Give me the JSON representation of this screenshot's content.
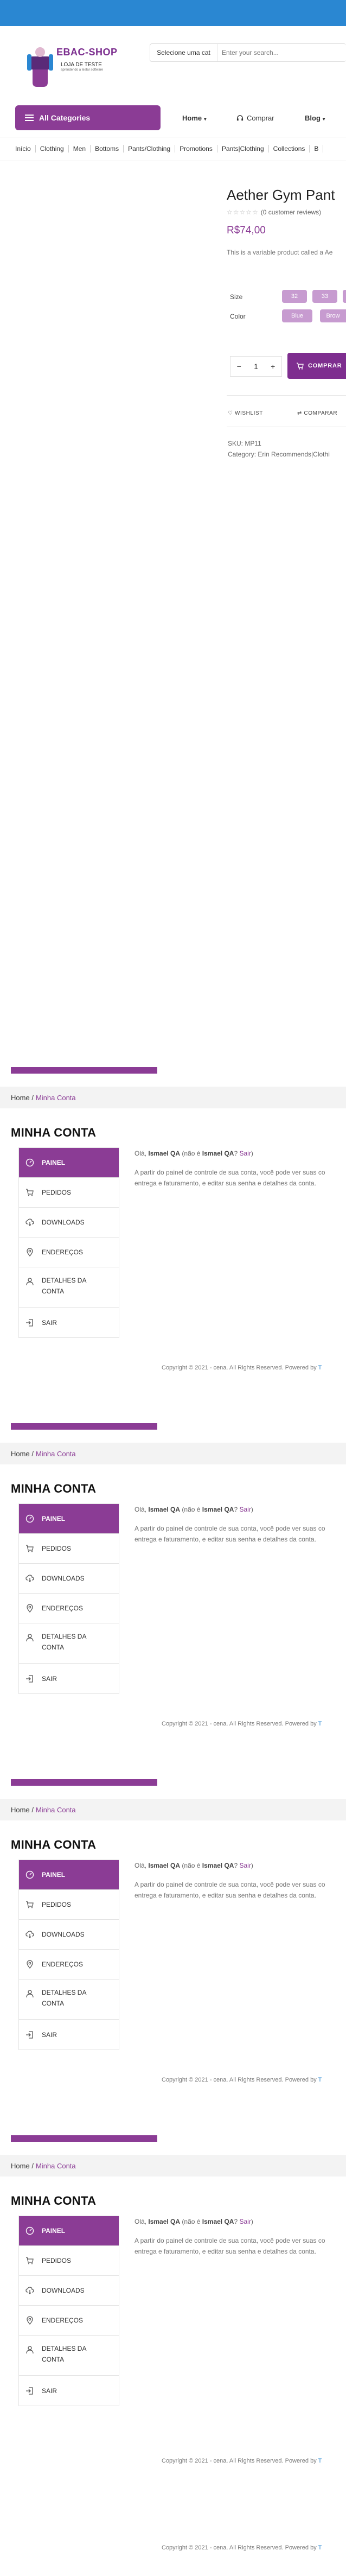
{
  "colors": {
    "topbar": "#2a87d2",
    "brand": "#8b3c95",
    "brand_dark": "#7e2e8f",
    "attr_button": "#c79bd0"
  },
  "logo": {
    "title": "EBAC-SHOP",
    "subtitle": "LOJA DE TESTE",
    "tagline": "aprendendo a testar software"
  },
  "search": {
    "category_label": "Selecione uma cat",
    "placeholder": "Enter your search..."
  },
  "nav": {
    "all_categories": "All Categories",
    "items": [
      {
        "label": "Home",
        "caret": "▾",
        "icon": ""
      },
      {
        "label": "Comprar",
        "caret": "",
        "icon": "headset-icon"
      },
      {
        "label": "Blog",
        "caret": "▾",
        "icon": ""
      }
    ]
  },
  "categories": [
    "Início",
    "Clothing",
    "Men",
    "Bottoms",
    "Pants/Clothing",
    "Promotions",
    "Pants|Clothing",
    "Collections",
    "B"
  ],
  "product": {
    "title": "Aether Gym Pant",
    "stars": "☆☆☆☆☆",
    "reviews": "(0 customer reviews)",
    "price": "R$74,00",
    "description": "This is a variable product called a Ae",
    "size_label": "Size",
    "sizes": [
      "32",
      "33",
      ""
    ],
    "color_label": "Color",
    "colors_options": [
      "Blue",
      "Brow"
    ],
    "qty_minus": "−",
    "qty_value": "1",
    "qty_plus": "+",
    "buy_label": "COMPRAR",
    "wishlist_label": "WISHLIST",
    "compare_label": "COMPARAR",
    "sku": "SKU: MP11",
    "category": "Category: Erin Recommends|Clothi"
  },
  "account_sections": [
    {
      "breadcrumb_home": "Home",
      "breadcrumb_sep": "/",
      "breadcrumb_current": "Minha Conta",
      "heading": "MINHA CONTA",
      "menu": [
        "PAINEL",
        "PEDIDOS",
        "DOWNLOADS",
        "ENDEREÇOS",
        "DETALHES DA CONTA",
        "SAIR"
      ],
      "greeting_prefix": "Olá,",
      "greeting_name": "Ismael QA",
      "greeting_mid": "(não é",
      "greeting_name2": "Ismael QA",
      "greeting_link": "Sair",
      "greeting_end": ")",
      "panel_line1": "A partir do painel de controle de sua conta, você pode ver suas co",
      "panel_line2": "entrega e faturamento, e editar sua senha e detalhes da conta.",
      "copyright": "Copyright © 2021 - cena. All Rights Reserved. Powered by",
      "copyright_link": "T"
    },
    {
      "breadcrumb_home": "Home",
      "breadcrumb_sep": "/",
      "breadcrumb_current": "Minha Conta",
      "heading": "MINHA CONTA",
      "menu": [
        "PAINEL",
        "PEDIDOS",
        "DOWNLOADS",
        "ENDEREÇOS",
        "DETALHES DA CONTA",
        "SAIR"
      ],
      "greeting_prefix": "Olá,",
      "greeting_name": "Ismael QA",
      "greeting_mid": "(não é",
      "greeting_name2": "Ismael QA",
      "greeting_link": "Sair",
      "greeting_end": ")",
      "panel_line1": "A partir do painel de controle de sua conta, você pode ver suas co",
      "panel_line2": "entrega e faturamento, e editar sua senha e detalhes da conta.",
      "copyright": "Copyright © 2021 - cena. All Rights Reserved. Powered by",
      "copyright_link": "T"
    },
    {
      "breadcrumb_home": "Home",
      "breadcrumb_sep": "/",
      "breadcrumb_current": "Minha Conta",
      "heading": "MINHA CONTA",
      "menu": [
        "PAINEL",
        "PEDIDOS",
        "DOWNLOADS",
        "ENDEREÇOS",
        "DETALHES DA CONTA",
        "SAIR"
      ],
      "greeting_prefix": "Olá,",
      "greeting_name": "Ismael QA",
      "greeting_mid": "(não é",
      "greeting_name2": "Ismael QA",
      "greeting_link": "Sair",
      "greeting_end": ")",
      "panel_line1": "A partir do painel de controle de sua conta, você pode ver suas co",
      "panel_line2": "entrega e faturamento, e editar sua senha e detalhes da conta.",
      "copyright": "Copyright © 2021 - cena. All Rights Reserved. Powered by",
      "copyright_link": "T"
    },
    {
      "breadcrumb_home": "Home",
      "breadcrumb_sep": "/",
      "breadcrumb_current": "Minha Conta",
      "heading": "MINHA CONTA",
      "menu": [
        "PAINEL",
        "PEDIDOS",
        "DOWNLOADS",
        "ENDEREÇOS",
        "DETALHES DA CONTA",
        "SAIR"
      ],
      "greeting_prefix": "Olá,",
      "greeting_name": "Ismael QA",
      "greeting_mid": "(não é",
      "greeting_name2": "Ismael QA",
      "greeting_link": "Sair",
      "greeting_end": ")",
      "panel_line1": "A partir do painel de controle de sua conta, você pode ver suas co",
      "panel_line2": "entrega e faturamento, e editar sua senha e detalhes da conta.",
      "copyright": "Copyright © 2021 - cena. All Rights Reserved. Powered by",
      "copyright_link": "T"
    }
  ],
  "final_copyright": "Copyright © 2021 - cena. All Rights Reserved. Powered by",
  "final_copyright_link": "T"
}
